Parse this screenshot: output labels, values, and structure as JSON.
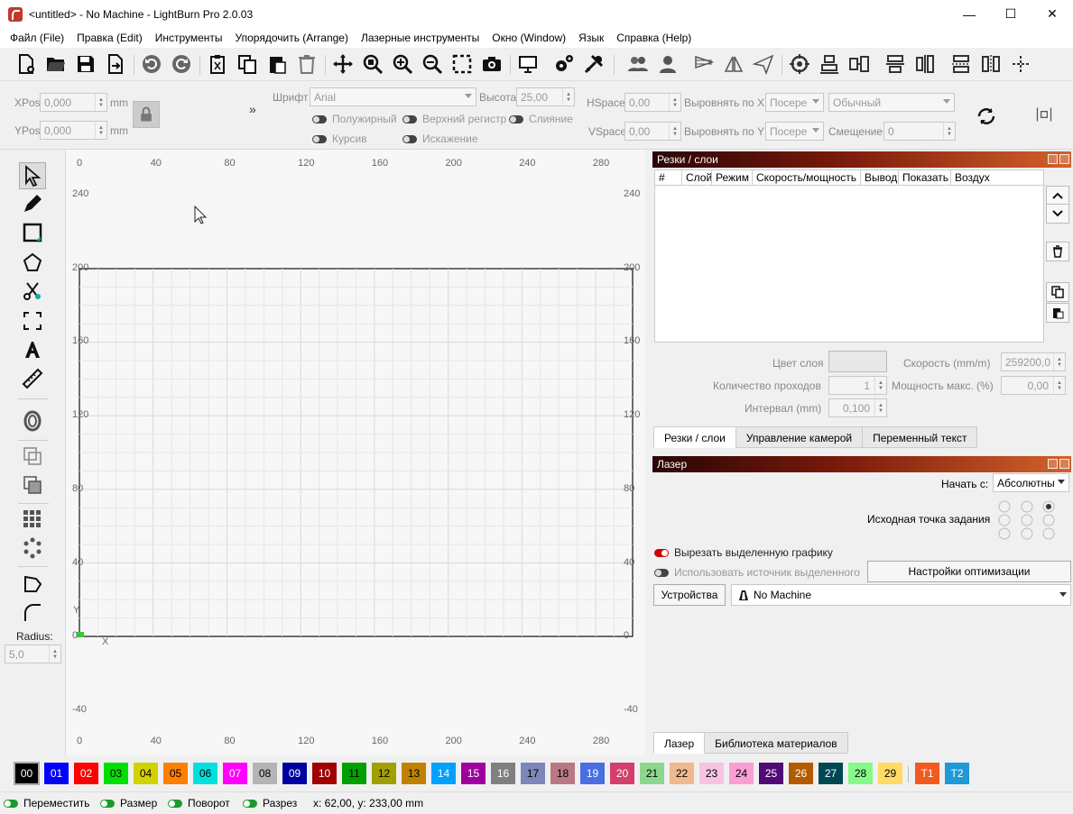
{
  "window": {
    "title": "<untitled> - No Machine - LightBurn Pro 2.0.03",
    "minimize": "—",
    "maximize": "☐",
    "close": "✕"
  },
  "menu": [
    "Файл (File)",
    "Правка (Edit)",
    "Инструменты",
    "Упорядочить (Arrange)",
    "Лазерные инструменты",
    "Окно (Window)",
    "Язык",
    "Справка (Help)"
  ],
  "position": {
    "xpos_label": "XPos",
    "xpos_value": "0,000",
    "ypos_label": "YPos",
    "ypos_value": "0,000",
    "unit": "mm"
  },
  "text_tools": {
    "font_label": "Шрифт",
    "font_value": "Arial",
    "height_label": "Высота",
    "height_value": "25,00",
    "bold": "Полужирный",
    "upper": "Верхний регистр",
    "merge": "Слияние",
    "italic": "Курсив",
    "distort": "Искажение",
    "hspace_label": "HSpace",
    "hspace_value": "0,00",
    "vspace_label": "VSpace",
    "vspace_value": "0,00",
    "align_x_label": "Выровнять по X",
    "align_x_value": "Посере",
    "align_y_label": "Выровнять по Y",
    "align_y_value": "Посере",
    "style_value": "Обычный",
    "offset_label": "Смещение",
    "offset_value": "0"
  },
  "collapse_glyph": "»",
  "left_tools": {
    "radius_label": "Radius:",
    "radius_value": "5,0"
  },
  "canvas": {
    "top_ruler": [
      "0",
      "40",
      "80",
      "120",
      "160",
      "200",
      "240",
      "280"
    ],
    "bottom_ruler": [
      "0",
      "40",
      "80",
      "120",
      "160",
      "200",
      "240",
      "280"
    ],
    "left_ruler": [
      "240",
      "200",
      "160",
      "120",
      "80",
      "40",
      "0",
      "-40"
    ],
    "right_ruler": [
      "240",
      "200",
      "160",
      "120",
      "80",
      "40",
      "0",
      "-40"
    ],
    "axis_x": "X",
    "axis_y": "Y"
  },
  "cuts": {
    "title": "Резки / слои",
    "columns": [
      "#",
      "Слой",
      "Режим",
      "Скорость/мощность",
      "Вывод",
      "Показать",
      "Воздух"
    ],
    "layer_color_label": "Цвет слоя",
    "speed_label": "Скорость (mm/m)",
    "speed_value": "259200,0",
    "passes_label": "Количество проходов",
    "passes_value": "1",
    "power_label": "Мощность макс. (%)",
    "power_value": "0,00",
    "interval_label": "Интервал (mm)",
    "interval_value": "0,100"
  },
  "tabs_top": [
    "Резки / слои",
    "Управление камерой",
    "Переменный текст"
  ],
  "laser": {
    "title": "Лазер",
    "start_label": "Начать с:",
    "start_value": "Абсолютны",
    "origin_label": "Исходная точка задания",
    "cut_selected": "Вырезать выделенную графику",
    "use_selection_origin": "Использовать источник выделенного",
    "optimize_button": "Настройки оптимизации",
    "devices_button": "Устройства",
    "device_value": "No Machine"
  },
  "tabs_bottom": [
    "Лазер",
    "Библиотека материалов"
  ],
  "palette": [
    {
      "label": "00",
      "color": "#000000",
      "text": "#ffffff"
    },
    {
      "label": "01",
      "color": "#0000ff",
      "text": "#ffffff"
    },
    {
      "label": "02",
      "color": "#ff0000",
      "text": "#ffffff"
    },
    {
      "label": "03",
      "color": "#00e000",
      "text": "#000000"
    },
    {
      "label": "04",
      "color": "#d2d200",
      "text": "#000000"
    },
    {
      "label": "05",
      "color": "#ff8000",
      "text": "#000000"
    },
    {
      "label": "06",
      "color": "#00e0e0",
      "text": "#000000"
    },
    {
      "label": "07",
      "color": "#ff00ff",
      "text": "#ffffff"
    },
    {
      "label": "08",
      "color": "#b4b4b4",
      "text": "#000000"
    },
    {
      "label": "09",
      "color": "#0000a0",
      "text": "#ffffff"
    },
    {
      "label": "10",
      "color": "#a00000",
      "text": "#ffffff"
    },
    {
      "label": "11",
      "color": "#00a000",
      "text": "#000000"
    },
    {
      "label": "12",
      "color": "#a0a000",
      "text": "#000000"
    },
    {
      "label": "13",
      "color": "#c08000",
      "text": "#000000"
    },
    {
      "label": "14",
      "color": "#00a0ff",
      "text": "#ffffff"
    },
    {
      "label": "15",
      "color": "#a000a0",
      "text": "#ffffff"
    },
    {
      "label": "16",
      "color": "#808080",
      "text": "#ffffff"
    },
    {
      "label": "17",
      "color": "#7d87b9",
      "text": "#000000"
    },
    {
      "label": "18",
      "color": "#bb7784",
      "text": "#000000"
    },
    {
      "label": "19",
      "color": "#4a6fe3",
      "text": "#ffffff"
    },
    {
      "label": "20",
      "color": "#d33f6a",
      "text": "#ffffff"
    },
    {
      "label": "21",
      "color": "#8cd78c",
      "text": "#000000"
    },
    {
      "label": "22",
      "color": "#f0b98d",
      "text": "#000000"
    },
    {
      "label": "23",
      "color": "#f6c4e1",
      "text": "#000000"
    },
    {
      "label": "24",
      "color": "#fa9ed4",
      "text": "#000000"
    },
    {
      "label": "25",
      "color": "#500a78",
      "text": "#ffffff"
    },
    {
      "label": "26",
      "color": "#b45a00",
      "text": "#ffffff"
    },
    {
      "label": "27",
      "color": "#004754",
      "text": "#ffffff"
    },
    {
      "label": "28",
      "color": "#86fa88",
      "text": "#000000"
    },
    {
      "label": "29",
      "color": "#ffdb66",
      "text": "#000000"
    },
    {
      "label": "T1",
      "color": "#f35a1e",
      "text": "#ffffff"
    },
    {
      "label": "T2",
      "color": "#1e9ad6",
      "text": "#ffffff"
    }
  ],
  "status": {
    "move": "Переместить",
    "size": "Размер",
    "rotate": "Поворот",
    "cut": "Разрез",
    "coords": "x: 62,00, y: 233,00 mm"
  }
}
